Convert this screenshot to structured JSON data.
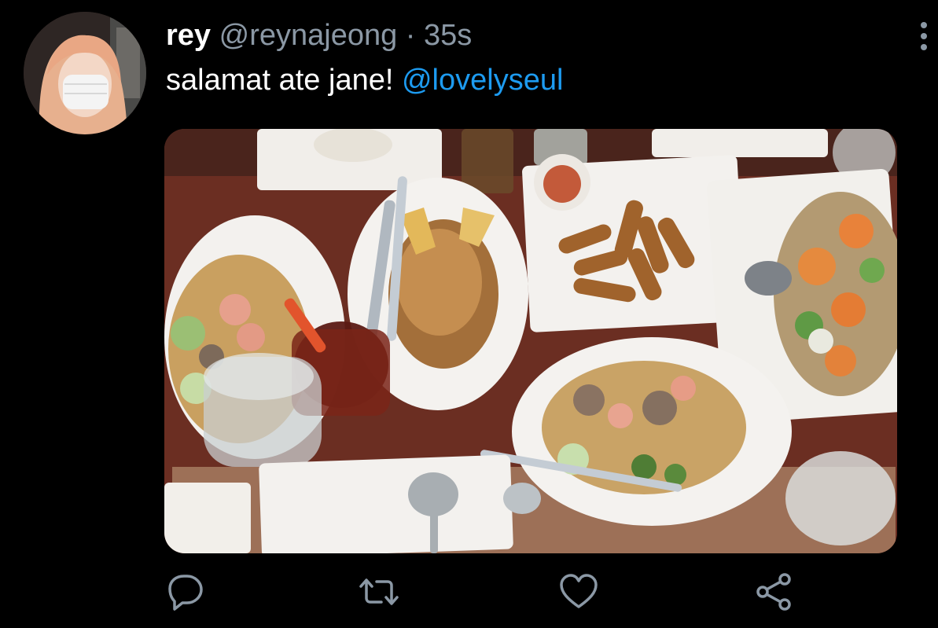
{
  "tweet": {
    "display_name": "rey",
    "handle": "@reynajeong",
    "separator": "·",
    "timestamp": "35s",
    "text": "salamat ate jane!",
    "mention": "@lovelyseul"
  },
  "media": {
    "icon": "photo-image"
  },
  "actions": {
    "reply_icon": "reply-icon",
    "retweet_icon": "retweet-icon",
    "like_icon": "heart-icon",
    "share_icon": "share-icon",
    "more_icon": "more-vertical-icon"
  },
  "colors": {
    "background": "#000000",
    "text": "#ffffff",
    "secondary": "#8b98a5",
    "link": "#1d9bf0"
  }
}
